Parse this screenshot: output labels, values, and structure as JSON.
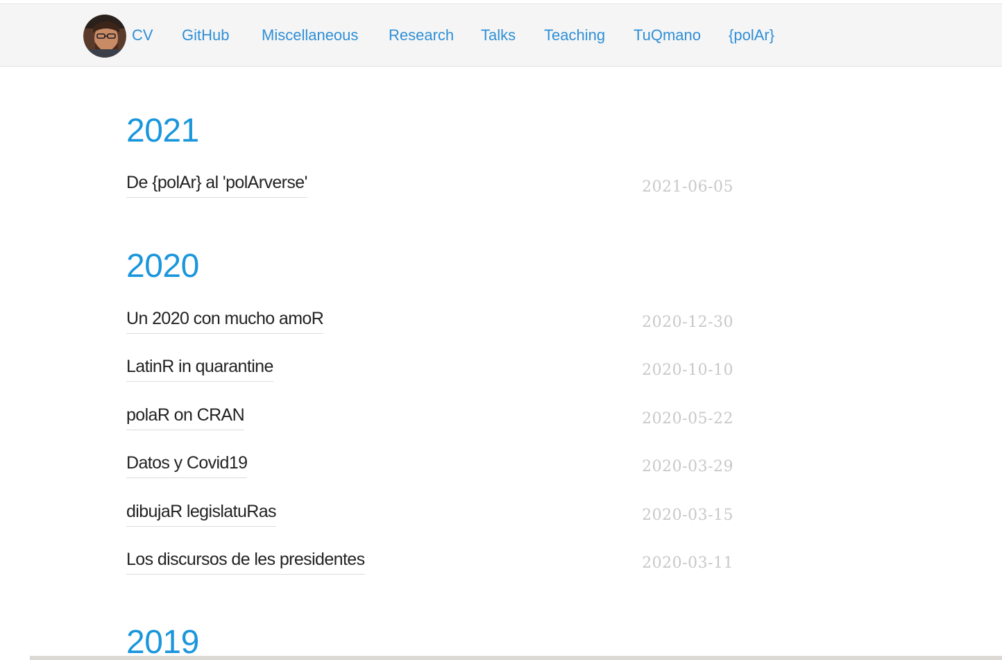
{
  "nav": {
    "avatar_alt": "profile photo",
    "links": [
      {
        "label": "CV"
      },
      {
        "label": "GitHub"
      },
      {
        "label": "Miscellaneous"
      },
      {
        "label": "Research"
      },
      {
        "label": "Talks"
      },
      {
        "label": "Teaching"
      },
      {
        "label": "TuQmano"
      },
      {
        "label": "{polAr}"
      }
    ],
    "link_color": "#2f8fd6"
  },
  "archive": {
    "year_color": "#1a96dc",
    "date_color": "#c8c8c8",
    "groups": [
      {
        "year": "2021",
        "posts": [
          {
            "title": "De {polAr} al 'polArverse'",
            "date": "2021-06-05"
          }
        ]
      },
      {
        "year": "2020",
        "posts": [
          {
            "title": "Un 2020 con mucho amoR",
            "date": "2020-12-30"
          },
          {
            "title": "LatinR in quarantine",
            "date": "2020-10-10"
          },
          {
            "title": "polaR on CRAN",
            "date": "2020-05-22"
          },
          {
            "title": "Datos y Covid19",
            "date": "2020-03-29"
          },
          {
            "title": "dibujaR legislatuRas",
            "date": "2020-03-15"
          },
          {
            "title": "Los discursos de les presidentes",
            "date": "2020-03-11"
          }
        ]
      },
      {
        "year": "2019",
        "posts": []
      }
    ]
  }
}
